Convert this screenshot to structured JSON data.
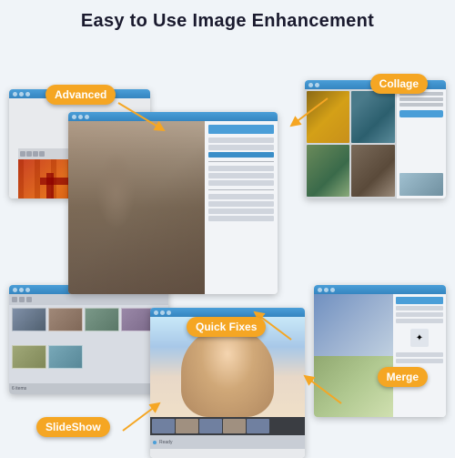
{
  "title": "Easy to Use Image Enhancement",
  "labels": {
    "advanced": "Advanced",
    "collage": "Collage",
    "quickfixes": "Quick Fixes",
    "slideshow": "SlideShow",
    "merge": "Merge"
  },
  "colors": {
    "accent": "#f5a623",
    "titlebar": "#4a9ed8",
    "background": "#f0f4f8"
  },
  "windows": {
    "advanced": {
      "name": "Advanced"
    },
    "collage": {
      "name": "Collage"
    },
    "center": {
      "name": "Quick Fixes"
    },
    "slideshow": {
      "name": "SlideShow"
    },
    "bottom": {
      "name": "Baby Photo"
    },
    "merge": {
      "name": "Merge"
    }
  }
}
